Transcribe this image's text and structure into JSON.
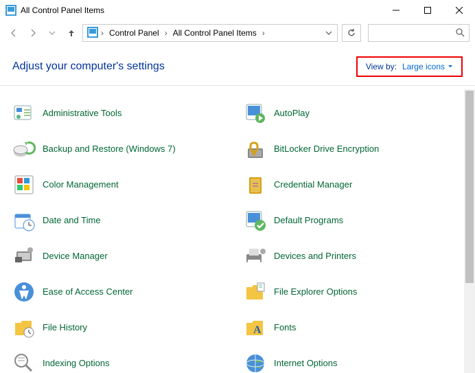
{
  "window": {
    "title": "All Control Panel Items"
  },
  "breadcrumb": {
    "root": "Control Panel",
    "current": "All Control Panel Items"
  },
  "header": {
    "heading": "Adjust your computer's settings",
    "viewby_label": "View by:",
    "viewby_value": "Large icons"
  },
  "items": {
    "left": [
      "Administrative Tools",
      "Backup and Restore (Windows 7)",
      "Color Management",
      "Date and Time",
      "Device Manager",
      "Ease of Access Center",
      "File History",
      "Indexing Options"
    ],
    "right": [
      "AutoPlay",
      "BitLocker Drive Encryption",
      "Credential Manager",
      "Default Programs",
      "Devices and Printers",
      "File Explorer Options",
      "Fonts",
      "Internet Options"
    ]
  }
}
